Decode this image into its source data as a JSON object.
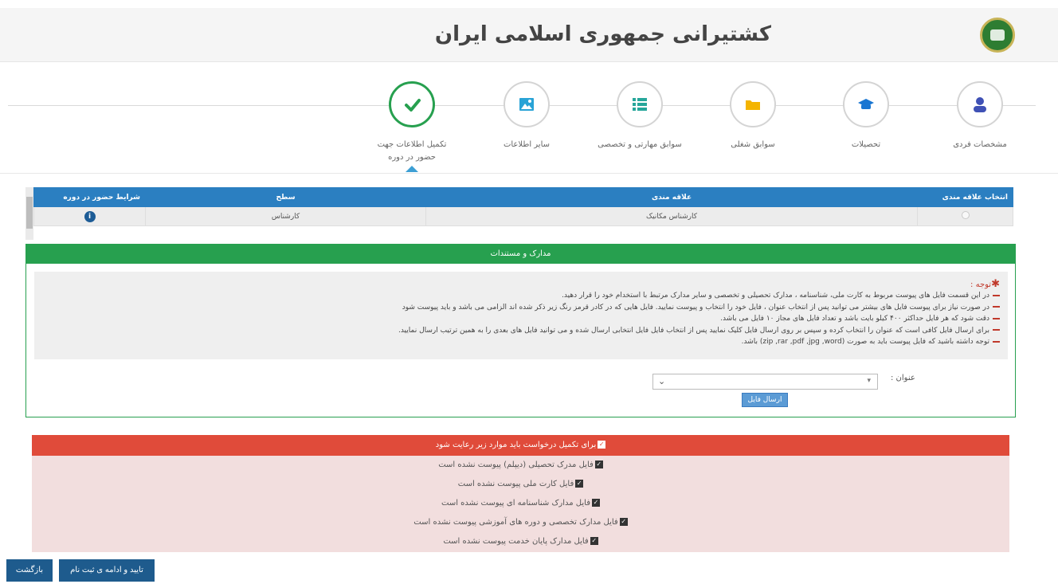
{
  "header": {
    "title": "کشتیرانی جمهوری اسلامی ایران"
  },
  "wizard": {
    "steps": [
      {
        "label": "مشخصات فردی",
        "icon": "person-icon",
        "color": "#3f51b5"
      },
      {
        "label": "تحصیلات",
        "icon": "graduation-cap-icon",
        "color": "#1976d2"
      },
      {
        "label": "سوابق شغلی",
        "icon": "folder-icon",
        "color": "#f4b400"
      },
      {
        "label": "سوابق مهارتی و تخصصی",
        "icon": "list-icon",
        "color": "#26a69a"
      },
      {
        "label": "سایر اطلاعات",
        "icon": "image-icon",
        "color": "#29a3d6"
      },
      {
        "label": "تکمیل اطلاعات جهت حضور در دوره",
        "icon": "check-icon",
        "color": "#27a04f"
      }
    ],
    "active_index": 5
  },
  "table": {
    "columns": [
      "انتخاب علاقه مندی",
      "علاقه مندی",
      "سطح",
      "شرایط حضور در دوره"
    ],
    "rows": [
      {
        "interest": "کارشناس مکانیک",
        "level": "کارشناس"
      }
    ]
  },
  "docs": {
    "header": "مدارک و مستندات",
    "notes_title": "توجه :",
    "notes": [
      "در این قسمت فایل های پیوست مربوط به کارت ملی، شناسنامه ، مدارک تحصیلی و تخصصی و سایر مدارک مرتبط با استخدام خود را قرار دهید.",
      "در صورت نیاز برای پیوست فایل های بیشتر می توانید پس از انتخاب عنوان ، فایل خود را انتخاب و پیوست نمایید. فایل هایی که در کادر قرمز رنگ زیر ذکر شده اند الزامی می باشد و باید پیوست شود",
      "دقت شود که هر فایل حداکثر ۴۰۰ کیلو بایت باشد و تعداد فایل های مجاز ۱۰ فایل می باشد.",
      "برای ارسال فایل کافی است که عنوان را انتخاب کرده و سپس بر روی ارسال فایل کلیک نمایید پس از انتخاب فایل فایل انتخابی ارسال شده و می توانید فایل های بعدی را به همین ترتیب ارسال نمایید.",
      "توجه داشته باشید که فایل پیوست باید به صورت (zip ,rar ,pdf ,jpg ,word) باشد."
    ],
    "title_label": "عنوان :",
    "send_button": "ارسال فایل"
  },
  "requirements": {
    "header": "برای تکمیل درخواست باید موارد زیر رعایت شود",
    "items": [
      "فایل مدرک تحصیلی (دیپلم) پیوست نشده است",
      "فایل کارت ملی پیوست نشده است",
      "فایل مدارک شناسنامه ای پیوست نشده است",
      "فایل مدارک تخصصی و دوره های آموزشی پیوست نشده است",
      "فایل مدارک پایان خدمت پیوست نشده است"
    ]
  },
  "footer": {
    "back_label": "بازگشت",
    "next_label": "تایید و ادامه ی ثبت نام"
  }
}
